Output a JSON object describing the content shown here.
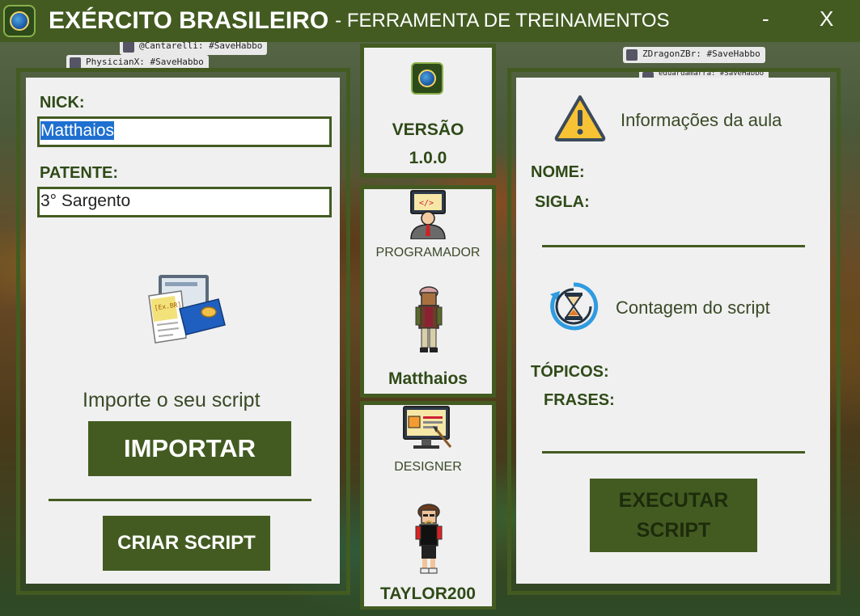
{
  "window": {
    "title_main": "EXÉRCITO BRASILEIRO",
    "title_sub": "- FERRAMENTA DE TREINAMENTOS",
    "minimize_label": "-",
    "close_label": "X"
  },
  "background_chat": [
    "@Cantarelli: #SaveHabbo",
    "PhysicianX: #SaveHabbo",
    "ZDragonZBr: #SaveHabbo",
    "eduardamarra: #SaveHabbo"
  ],
  "left_panel": {
    "nick_label": "NICK:",
    "nick_value": "Matthaios",
    "patente_label": "PATENTE:",
    "patente_value": "3° Sargento",
    "import_caption": "Importe o seu script",
    "import_button": "IMPORTAR",
    "create_button": "CRIAR SCRIPT",
    "doc_icon_tag": "[Ex.BR]"
  },
  "middle_panel": {
    "version_label": "VERSÃO",
    "version_value": "1.0.0",
    "programmer_role": "PROGRAMADOR",
    "programmer_name": "Matthaios",
    "designer_role": "DESIGNER",
    "designer_name": "TAYLOR200"
  },
  "right_panel": {
    "info_title": "Informações da aula",
    "nome_label": "NOME:",
    "sigla_label": "SIGLA:",
    "count_title": "Contagem do script",
    "topicos_label": "TÓPICOS:",
    "frases_label": "FRASES:",
    "execute_button": "EXECUTAR SCRIPT"
  },
  "colors": {
    "primary_green": "#435b21",
    "panel_bg": "#f0f0f0",
    "label_text": "#2f4a17",
    "selection_blue": "#1e6fd0"
  },
  "icons": {
    "app": "globe-logo-icon",
    "warning": "warning-triangle-icon",
    "timer": "hourglass-refresh-icon",
    "import": "document-wallet-icon",
    "programmer": "programmer-icon",
    "designer": "designer-monitor-icon"
  }
}
